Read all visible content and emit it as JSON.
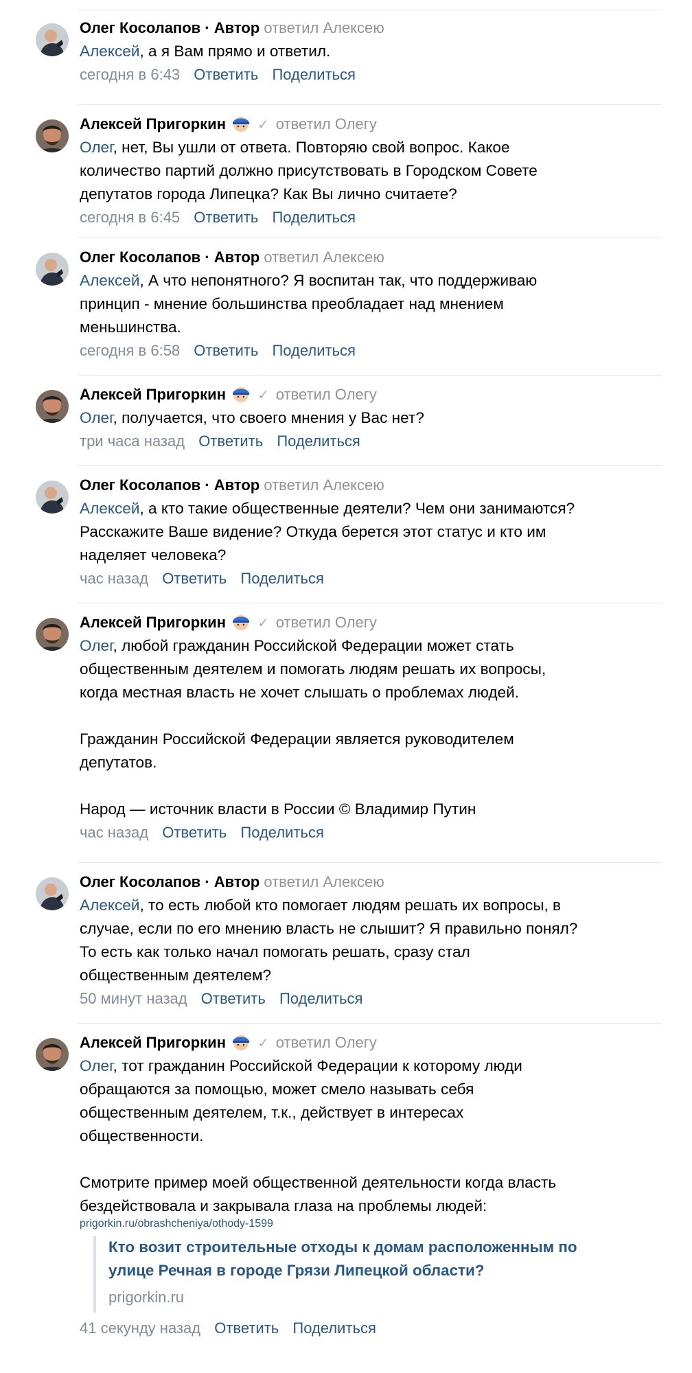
{
  "labels": {
    "reply": "Ответить",
    "share": "Поделиться"
  },
  "comments": [
    {
      "author": "Олег Косолапов · Автор",
      "reply_to": "ответил Алексею",
      "mention": "Алексей",
      "text": ", а я Вам прямо и ответил.",
      "date": "сегодня в 6:43"
    },
    {
      "author": "Алексей Пригоркин",
      "reply_to": "ответил Олегу",
      "mention": "Олег",
      "text": ", нет, Вы ушли от ответа. Повторяю свой вопрос. Какое\nколичество партий должно присутствовать в Городском Совете\nдепутатов города Липецка? Как Вы лично считаете?",
      "date": "сегодня в 6:45"
    },
    {
      "author": "Олег Косолапов · Автор",
      "reply_to": "ответил Алексею",
      "mention": "Алексей",
      "text": ", А что непонятного? Я воспитан так, что поддерживаю\nпринцип - мнение большинства преобладает над мнением\nменьшинства.",
      "date": "сегодня в 6:58"
    },
    {
      "author": "Алексей Пригоркин",
      "reply_to": "ответил Олегу",
      "mention": "Олег",
      "text": ", получается, что своего мнения у Вас нет?",
      "date": "три часа назад"
    },
    {
      "author": "Олег Косолапов · Автор",
      "reply_to": "ответил Алексею",
      "mention": "Алексей",
      "text": ", а кто такие общественные деятели? Чем они занимаются?\nРасскажите Ваше видение? Откуда берется этот статус и кто им\nнаделяет человека?",
      "date": "час назад"
    },
    {
      "author": "Алексей Пригоркин",
      "reply_to": "ответил Олегу",
      "mention": "Олег",
      "text": ", любой гражданин Российской Федерации может стать\nобщественным деятелем и помогать людям решать их вопросы,\nкогда местная власть не хочет слышать о проблемах людей.\n\nГражданин Российской Федерации является руководителем\nдепутатов.\n\nНарод — источник власти в России © Владимир Путин",
      "date": "час назад"
    },
    {
      "author": "Олег Косолапов · Автор",
      "reply_to": "ответил Алексею",
      "mention": "Алексей",
      "text": ", то есть любой кто помогает людям решать их вопросы, в\nслучае, если по его мнению власть не слышит? Я правильно понял?\nТо есть как только начал помогать решать, сразу стал\nобщественным деятелем?",
      "date": "50 минут назад"
    },
    {
      "author": "Алексей Пригоркин",
      "reply_to": "ответил Олегу",
      "mention": "Олег",
      "text": ", тот гражданин Российской Федерации к которому люди\nобращаются за помощью, может смело называть себя\nобщественным деятелем, т.к., действует в интересах\nобщественности.\n\nСмотрите пример моей общественной деятельности когда власть\nбездействовала и закрывала глаза на проблемы людей:",
      "link": "prigorkin.ru/obrashcheniya/othody-1599",
      "snippet_title": "Кто возит строительные отходы к домам расположенным по\nулице Речная в городе Грязи Липецкой области?",
      "snippet_domain": "prigorkin.ru",
      "date": "41 секунду назад"
    }
  ],
  "colors": {
    "link": "#2a5885",
    "meta": "#818c99",
    "reply_to": "#939393",
    "divider": "#e3e4e6"
  },
  "icons": {
    "oleg_avatar": "avatar-oleg",
    "aleksey_avatar": "avatar-aleksey",
    "emoji": "blue-helmet-emoji-icon",
    "verified": "checkmark-icon"
  }
}
